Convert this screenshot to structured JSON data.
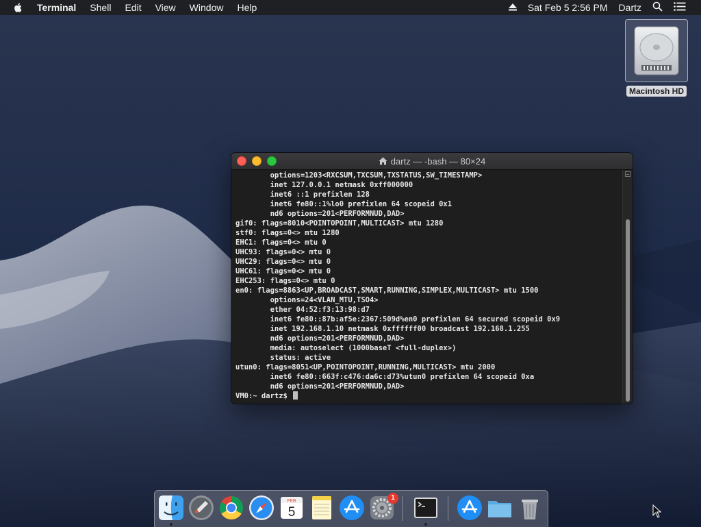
{
  "menubar": {
    "apple_icon": "apple-logo-icon",
    "app_name": "Terminal",
    "menus": [
      "Shell",
      "Edit",
      "View",
      "Window",
      "Help"
    ],
    "datetime": "Sat Feb 5  2:56 PM",
    "user": "Dartz"
  },
  "desktop": {
    "disk_label": "Macintosh HD"
  },
  "terminal": {
    "title": "dartz — -bash — 80×24",
    "lines": [
      "        options=1203<RXCSUM,TXCSUM,TXSTATUS,SW_TIMESTAMP>",
      "        inet 127.0.0.1 netmask 0xff000000",
      "        inet6 ::1 prefixlen 128",
      "        inet6 fe80::1%lo0 prefixlen 64 scopeid 0x1",
      "        nd6 options=201<PERFORMNUD,DAD>",
      "gif0: flags=8010<POINTOPOINT,MULTICAST> mtu 1280",
      "stf0: flags=0<> mtu 1280",
      "EHC1: flags=0<> mtu 0",
      "UHC93: flags=0<> mtu 0",
      "UHC29: flags=0<> mtu 0",
      "UHC61: flags=0<> mtu 0",
      "EHC253: flags=0<> mtu 0",
      "en0: flags=8863<UP,BROADCAST,SMART,RUNNING,SIMPLEX,MULTICAST> mtu 1500",
      "        options=24<VLAN_MTU,TSO4>",
      "        ether 04:52:f3:13:98:d7",
      "        inet6 fe80::87b:af5e:2367:509d%en0 prefixlen 64 secured scopeid 0x9",
      "        inet 192.168.1.10 netmask 0xffffff00 broadcast 192.168.1.255",
      "        nd6 options=201<PERFORMNUD,DAD>",
      "        media: autoselect (1000baseT <full-duplex>)",
      "        status: active",
      "utun0: flags=8051<UP,POINTOPOINT,RUNNING,MULTICAST> mtu 2000",
      "        inet6 fe80::663f:c476:da6c:d73%utun0 prefixlen 64 scopeid 0xa",
      "        nd6 options=201<PERFORMNUD,DAD>"
    ],
    "prompt": "VM0:~ dartz$ "
  },
  "dock": {
    "items": [
      {
        "name": "finder",
        "icon": "finder-icon",
        "running": true
      },
      {
        "name": "launchpad",
        "icon": "launchpad-icon",
        "running": false
      },
      {
        "name": "chrome",
        "icon": "chrome-icon",
        "running": false
      },
      {
        "name": "safari",
        "icon": "safari-icon",
        "running": false
      },
      {
        "name": "calendar",
        "icon": "calendar-icon",
        "running": false,
        "month": "FEB",
        "day": "5"
      },
      {
        "name": "notes",
        "icon": "notes-icon",
        "running": false
      },
      {
        "name": "app-store",
        "icon": "app-store-icon",
        "running": false
      },
      {
        "name": "system-preferences",
        "icon": "gear-icon",
        "running": false,
        "badge": "1"
      },
      {
        "name": "terminal",
        "icon": "terminal-icon",
        "running": true
      },
      {
        "name": "app-store-folder",
        "icon": "app-store-icon",
        "running": false
      },
      {
        "name": "documents-folder",
        "icon": "folder-icon",
        "running": false
      },
      {
        "name": "trash",
        "icon": "trash-icon",
        "running": false
      }
    ]
  },
  "colors": {
    "close": "#fe5f57",
    "minimize": "#febb2e",
    "zoom": "#29c840",
    "terminal_bg": "#1e1e1e",
    "terminal_text": "#e8e8e8"
  }
}
